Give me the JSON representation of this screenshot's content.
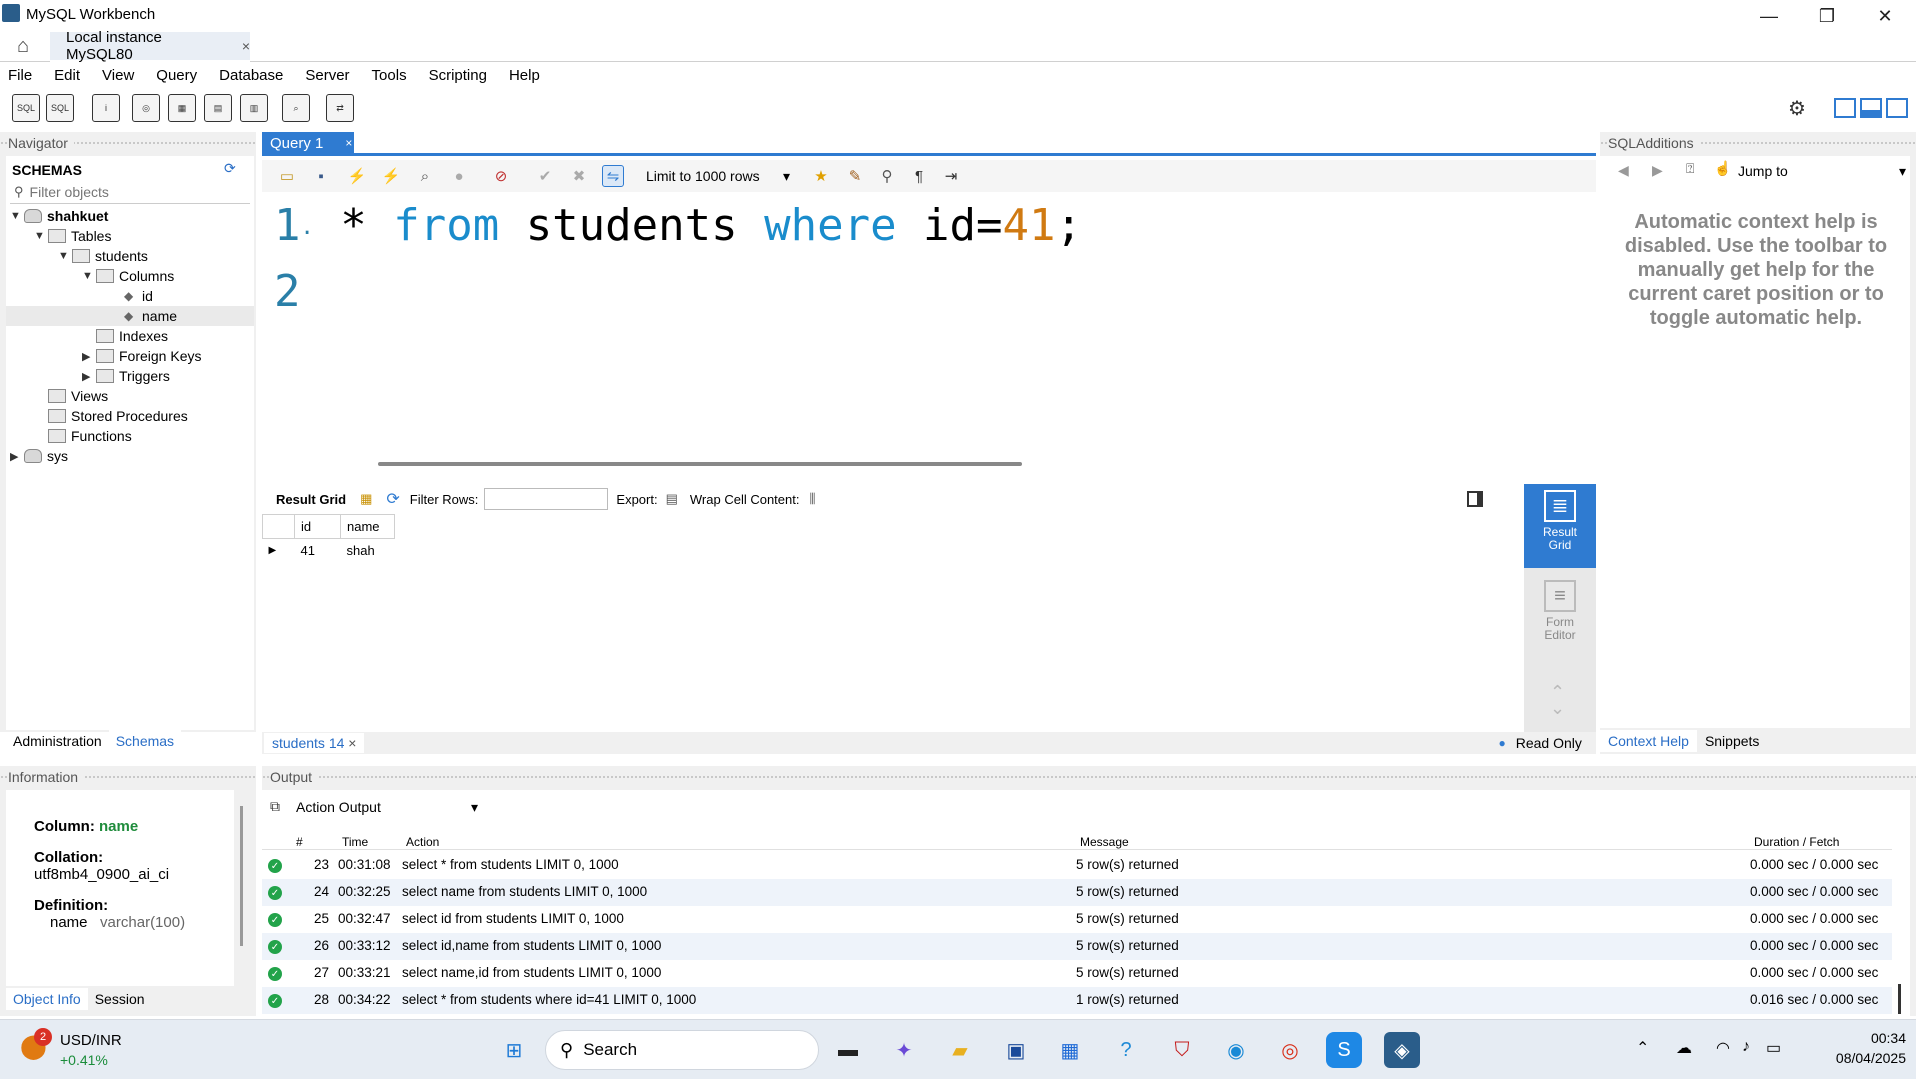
{
  "window": {
    "title": "MySQL Workbench",
    "min": "—",
    "max": "❐",
    "close": "✕"
  },
  "tabstrip": {
    "instance_tab": "Local instance MySQL80",
    "close": "×"
  },
  "menu": [
    "File",
    "Edit",
    "View",
    "Query",
    "Database",
    "Server",
    "Tools",
    "Scripting",
    "Help"
  ],
  "navigator": {
    "header": "Navigator",
    "schemas_label": "SCHEMAS",
    "filter_placeholder": "Filter objects",
    "tree": {
      "schema1": "shahkuet",
      "tables": "Tables",
      "students": "students",
      "columns": "Columns",
      "col_id": "id",
      "col_name": "name",
      "indexes": "Indexes",
      "foreign_keys": "Foreign Keys",
      "triggers": "Triggers",
      "views": "Views",
      "stored_procedures": "Stored Procedures",
      "functions": "Functions",
      "schema2": "sys"
    },
    "tabs": [
      "Administration",
      "Schemas"
    ]
  },
  "information": {
    "header": "Information",
    "column_label": "Column:",
    "column_value": "name",
    "collation_label": "Collation:",
    "collation_value": "utf8mb4_0900_ai_ci",
    "definition_label": "Definition:",
    "def_name": "name",
    "def_type": "varchar(100)",
    "tabs": [
      "Object Info",
      "Session"
    ]
  },
  "query": {
    "tab_label": "Query 1",
    "tab_close": "×",
    "limit": "Limit to 1000 rows",
    "lines": [
      {
        "num": "1",
        "dot": "·",
        "star": " * ",
        "kw1": "from",
        "mid": " students ",
        "kw2": "where",
        "cond": " id=",
        "val": "41",
        "end": ";"
      },
      {
        "num": "2"
      }
    ]
  },
  "result": {
    "result_grid_label": "Result Grid",
    "filter_rows_label": "Filter Rows:",
    "export_label": "Export:",
    "wrap_label": "Wrap Cell Content:",
    "columns": [
      "id",
      "name"
    ],
    "rows": [
      [
        "41",
        "shah"
      ]
    ],
    "side_result_grid": "Result Grid",
    "side_form_editor": "Form Editor",
    "bottom_tab": "students 14",
    "bottom_tab_close": "×",
    "read_only": "Read Only"
  },
  "sqladditions": {
    "header": "SQLAdditions",
    "jump_to": "Jump to",
    "help_text": "Automatic context help is disabled. Use the toolbar to manually get help for the current caret position or to toggle automatic help.",
    "tabs": [
      "Context Help",
      "Snippets"
    ]
  },
  "output": {
    "header": "Output",
    "selector": "Action Output",
    "columns": [
      "#",
      "Time",
      "Action",
      "Message",
      "Duration / Fetch"
    ],
    "rows": [
      {
        "n": "23",
        "time": "00:31:08",
        "action": "select * from students LIMIT 0, 1000",
        "msg": "5 row(s) returned",
        "dur": "0.000 sec / 0.000 sec"
      },
      {
        "n": "24",
        "time": "00:32:25",
        "action": "select name from students LIMIT 0, 1000",
        "msg": "5 row(s) returned",
        "dur": "0.000 sec / 0.000 sec"
      },
      {
        "n": "25",
        "time": "00:32:47",
        "action": "select id from students LIMIT 0, 1000",
        "msg": "5 row(s) returned",
        "dur": "0.000 sec / 0.000 sec"
      },
      {
        "n": "26",
        "time": "00:33:12",
        "action": "select id,name from students LIMIT 0, 1000",
        "msg": "5 row(s) returned",
        "dur": "0.000 sec / 0.000 sec"
      },
      {
        "n": "27",
        "time": "00:33:21",
        "action": "select name,id from students LIMIT 0, 1000",
        "msg": "5 row(s) returned",
        "dur": "0.000 sec / 0.000 sec"
      },
      {
        "n": "28",
        "time": "00:34:22",
        "action": "select * from students where id=41 LIMIT 0, 1000",
        "msg": "1 row(s) returned",
        "dur": "0.016 sec / 0.000 sec"
      }
    ]
  },
  "taskbar": {
    "widget_title": "USD/INR",
    "widget_change": "+0.41%",
    "widget_badge": "2",
    "search": "Search",
    "time": "00:34",
    "date": "08/04/2025"
  }
}
